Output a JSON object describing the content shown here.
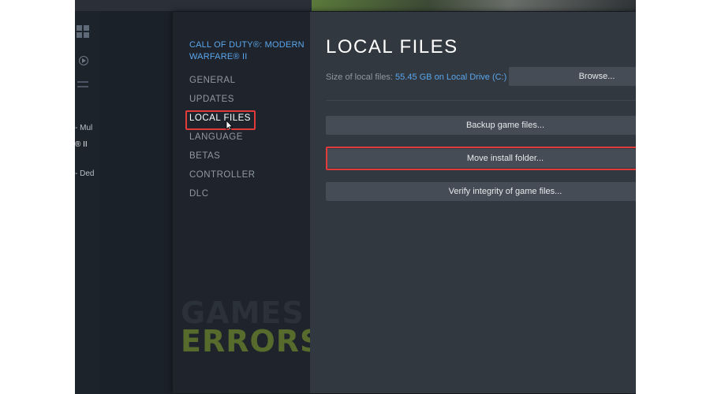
{
  "background": {
    "list_items": [
      "- Mul",
      "® II",
      "- Ded"
    ]
  },
  "dialog": {
    "game_title": "CALL OF DUTY®: MODERN WARFARE® II",
    "nav": [
      "GENERAL",
      "UPDATES",
      "LOCAL FILES",
      "LANGUAGE",
      "BETAS",
      "CONTROLLER",
      "DLC"
    ],
    "active_nav": "LOCAL FILES",
    "close_glyph": "×",
    "page_title": "LOCAL FILES",
    "size_label": "Size of local files:",
    "size_value": "55.45 GB on Local Drive (C:)",
    "browse_label": "Browse...",
    "backup_label": "Backup game files...",
    "move_label": "Move install folder...",
    "verify_label": "Verify integrity of game files..."
  },
  "watermark": {
    "line1": "GAMES",
    "line2": "ERRORS"
  },
  "colors": {
    "highlight": "#e03a3a",
    "link": "#5aa6ec",
    "panel": "#32383f",
    "button": "#454c55"
  },
  "icons": [
    "grid-icon",
    "play-icon",
    "slider-icon",
    "cursor-icon",
    "close-icon"
  ]
}
